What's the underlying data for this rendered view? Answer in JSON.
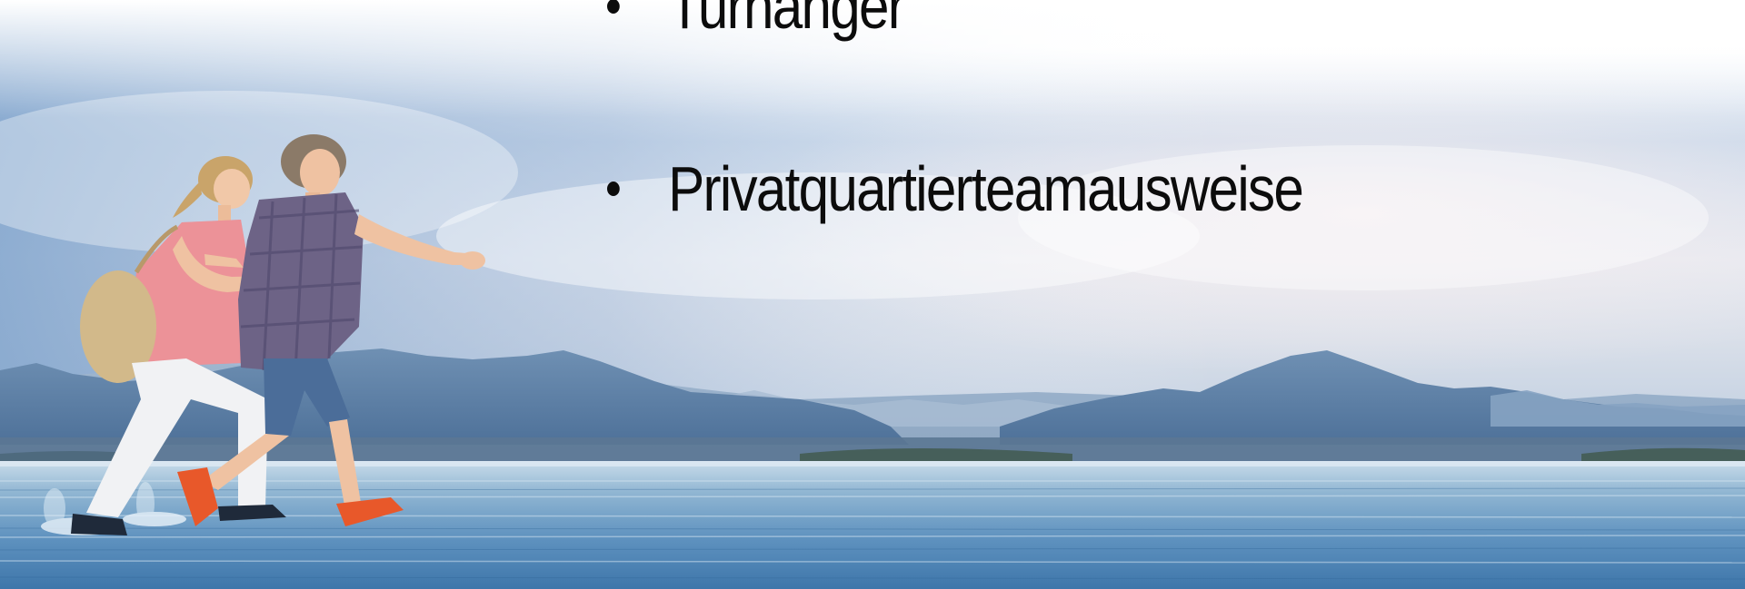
{
  "slide": {
    "bullets": [
      {
        "text": "Turnanger"
      },
      {
        "text": "Privatquartierteamausweise"
      }
    ]
  },
  "colors": {
    "text": "#0c0c0c",
    "sky_top": "#ffffff",
    "sky_mid": "#9db8d6",
    "mountains": "#5a7fa6",
    "water": "#6f9fc4"
  }
}
